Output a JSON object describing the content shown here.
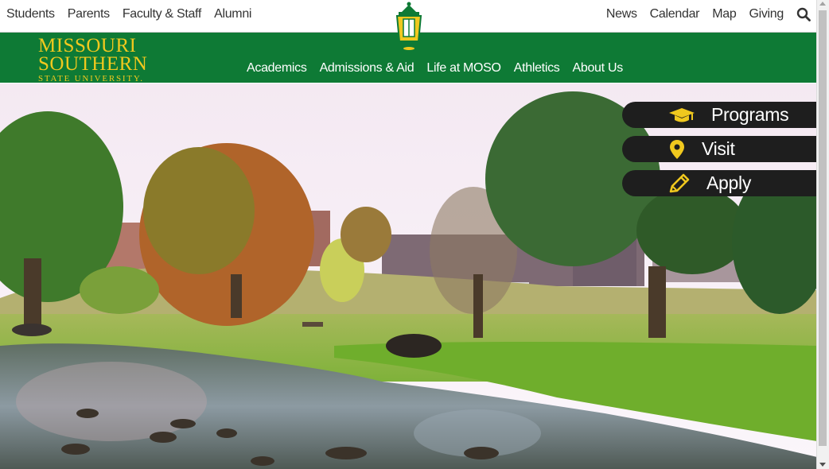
{
  "utility_nav": {
    "left": [
      "Students",
      "Parents",
      "Faculty & Staff",
      "Alumni"
    ],
    "right": [
      "News",
      "Calendar",
      "Map",
      "Giving"
    ]
  },
  "logo": {
    "line1": "MISSOURI",
    "line2": "SOUTHERN",
    "line3": "STATE UNIVERSITY."
  },
  "main_nav": [
    "Academics",
    "Admissions & Aid",
    "Life at MOSO",
    "Athletics",
    "About Us"
  ],
  "cta_buttons": [
    {
      "label": "Programs",
      "icon": "graduation-cap-icon"
    },
    {
      "label": "Visit",
      "icon": "map-marker-icon"
    },
    {
      "label": "Apply",
      "icon": "pencil-icon"
    }
  ],
  "colors": {
    "brand_green": "#0e7a35",
    "brand_gold": "#f0c81e",
    "cta_bg": "#1e1e1e"
  }
}
